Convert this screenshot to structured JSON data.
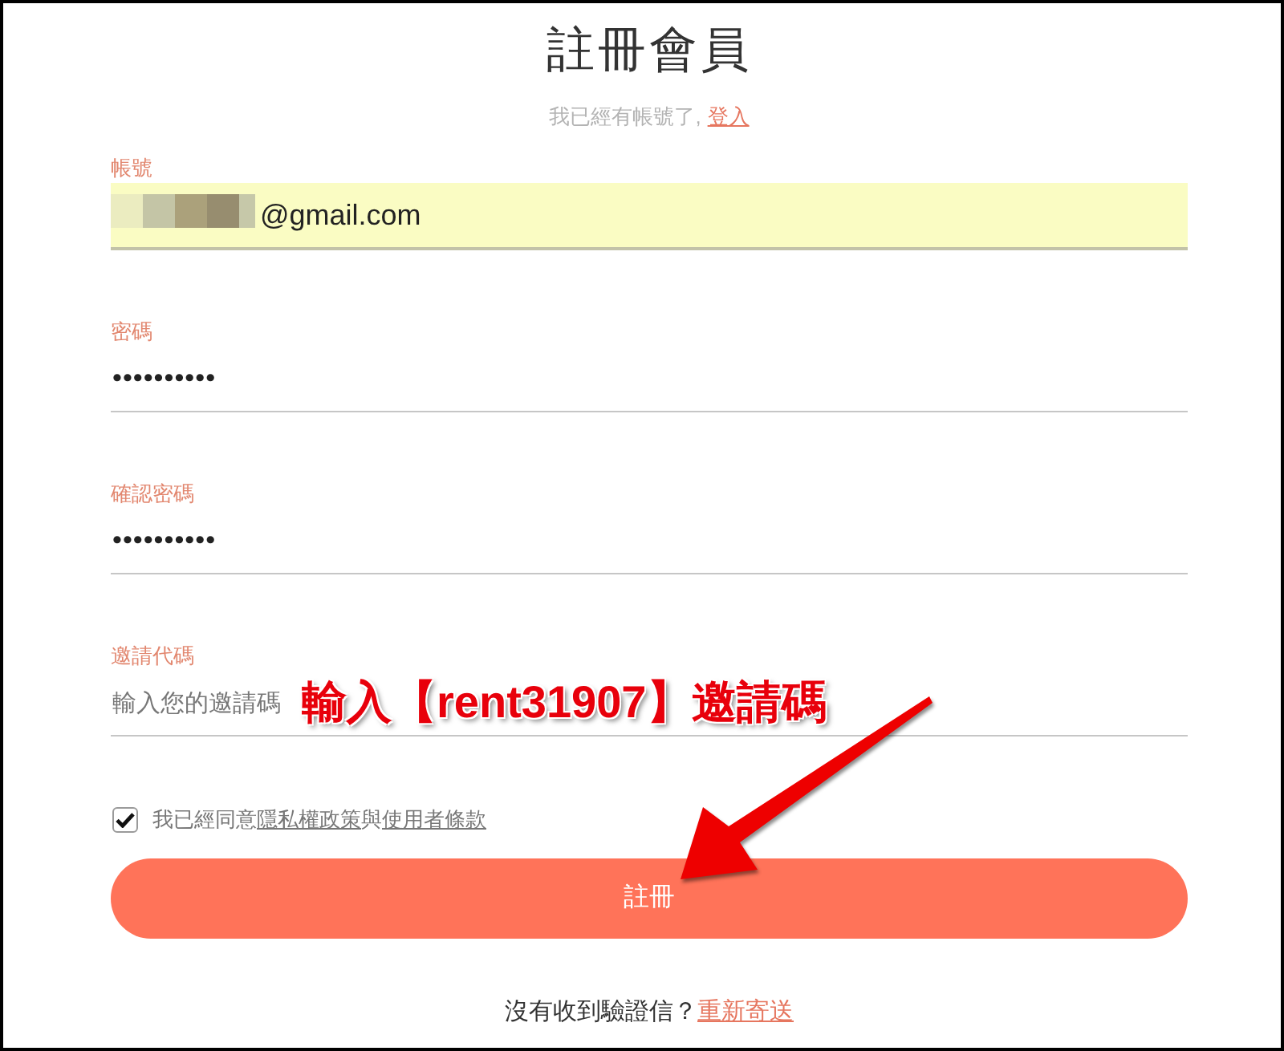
{
  "title": "註冊會員",
  "login_prompt": {
    "text": "我已經有帳號了,",
    "link": "登入"
  },
  "fields": [
    {
      "kind": "email",
      "label": "帳號",
      "value": "@gmail.com",
      "autofilled": true,
      "masked": true
    },
    {
      "kind": "password",
      "label": "密碼",
      "value": "••••••••••"
    },
    {
      "kind": "password",
      "label": "確認密碼",
      "value": "••••••••••"
    },
    {
      "kind": "text",
      "label": "邀請代碼",
      "placeholder": "輸入您的邀請碼"
    }
  ],
  "agreement": {
    "checked": true,
    "segments": [
      {
        "kind": "text",
        "text": "我已經同意"
      },
      {
        "kind": "link",
        "text": "隱私權政策"
      },
      {
        "kind": "text",
        "text": "與"
      },
      {
        "kind": "link",
        "text": "使用者條款"
      }
    ]
  },
  "register_button": "註冊",
  "resend_prompt": {
    "text": "沒有收到驗證信？",
    "link": "重新寄送"
  },
  "annotation": {
    "text": "輸入【rent31907】邀請碼",
    "arrow": true
  }
}
